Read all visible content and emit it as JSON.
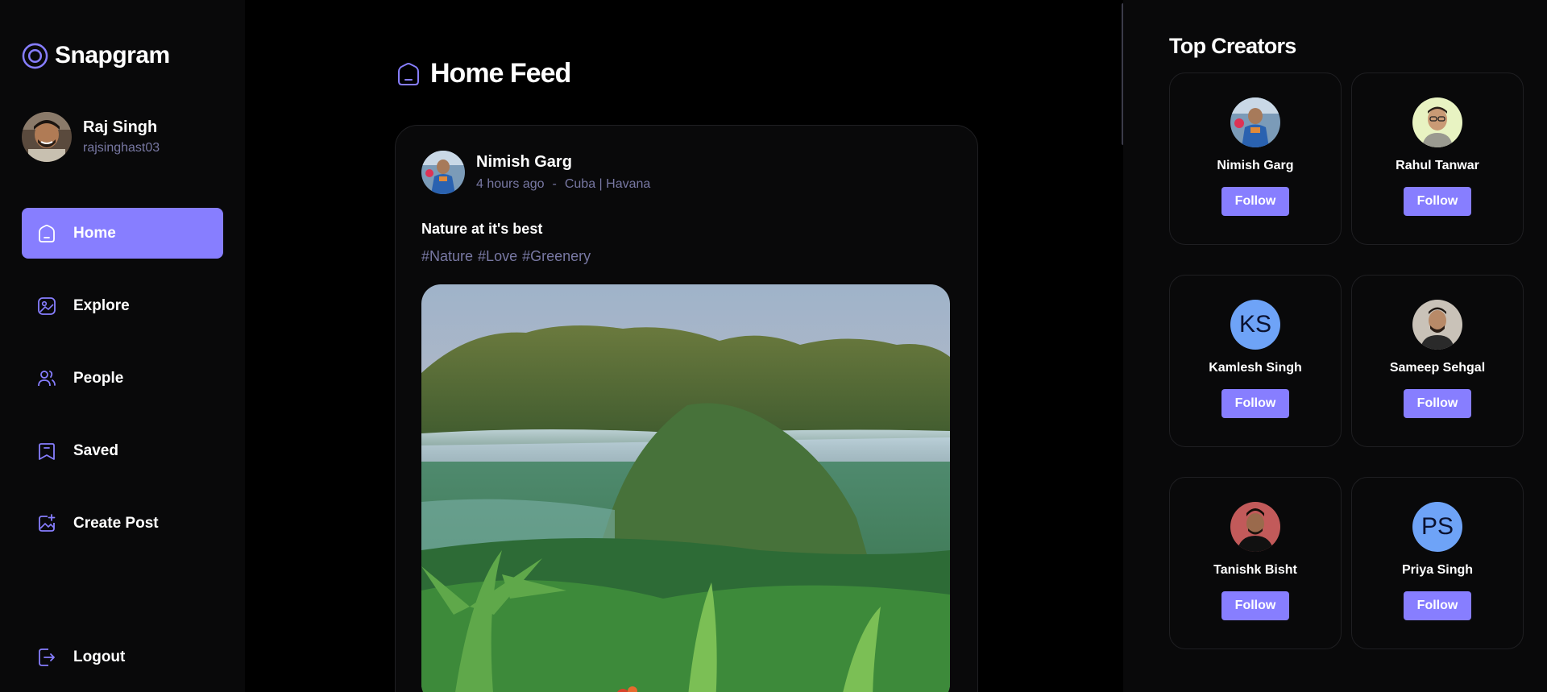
{
  "app": {
    "name": "Snapgram",
    "accent": "#877eff",
    "secondary_text": "#7878a3"
  },
  "user": {
    "name": "Raj Singh",
    "handle": "rajsinghast03"
  },
  "nav": {
    "items": [
      {
        "label": "Home",
        "icon": "home-icon",
        "active": true
      },
      {
        "label": "Explore",
        "icon": "explore-icon",
        "active": false
      },
      {
        "label": "People",
        "icon": "people-icon",
        "active": false
      },
      {
        "label": "Saved",
        "icon": "bookmark-icon",
        "active": false
      },
      {
        "label": "Create Post",
        "icon": "create-post-icon",
        "active": false
      }
    ],
    "logout_label": "Logout"
  },
  "feed": {
    "title": "Home Feed",
    "post": {
      "author": "Nimish Garg",
      "time": "4 hours ago",
      "separator": "-",
      "location": "Cuba | Havana",
      "caption": "Nature at it's best",
      "tags": [
        "#Nature",
        "#Love",
        "#Greenery"
      ]
    }
  },
  "top_creators": {
    "title": "Top Creators",
    "follow_label": "Follow",
    "creators": [
      {
        "name": "Nimish Garg",
        "avatar": "photo"
      },
      {
        "name": "Rahul Tanwar",
        "avatar": "photo"
      },
      {
        "name": "Kamlesh Singh",
        "avatar": "initials",
        "initials": "KS"
      },
      {
        "name": "Sameep Sehgal",
        "avatar": "photo"
      },
      {
        "name": "Tanishk Bisht",
        "avatar": "photo"
      },
      {
        "name": "Priya Singh",
        "avatar": "initials",
        "initials": "PS"
      }
    ]
  }
}
